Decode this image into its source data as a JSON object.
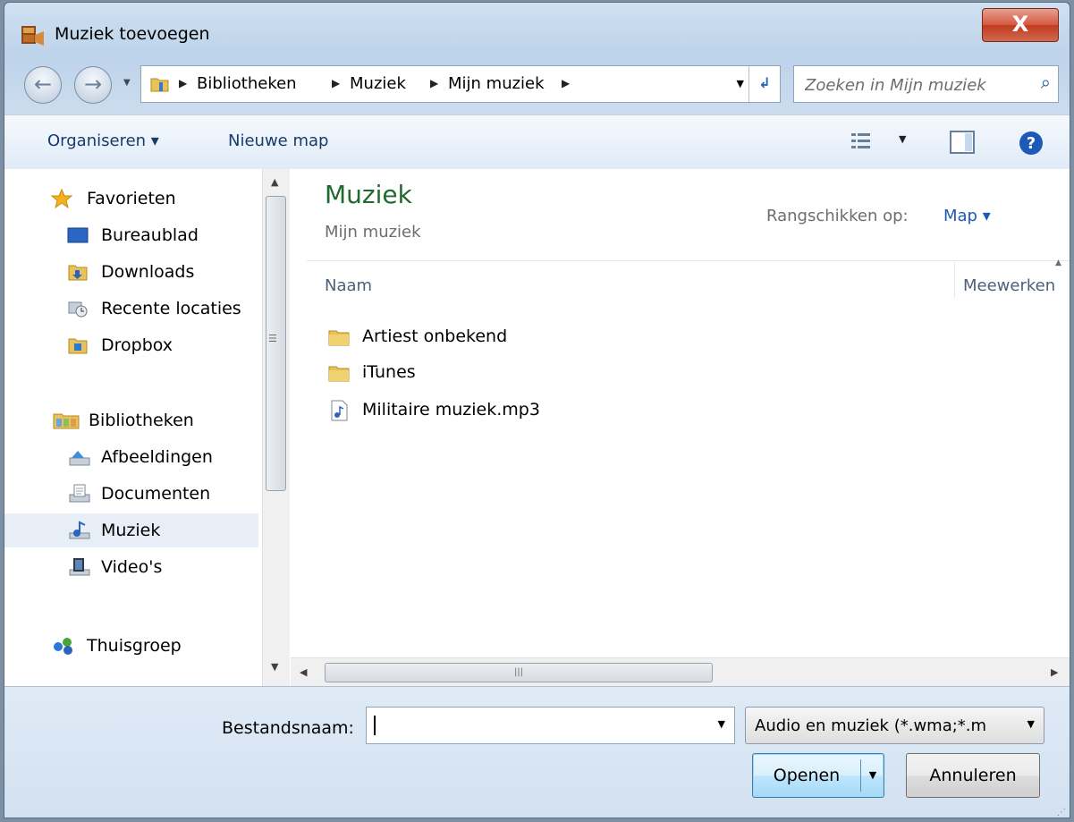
{
  "window": {
    "title": "Muziek toevoegen",
    "close_label": "X"
  },
  "navigation": {
    "back_glyph": "←",
    "forward_glyph": "→",
    "breadcrumbs": [
      "Bibliotheken",
      "Muziek",
      "Mijn muziek"
    ],
    "search_placeholder": "Zoeken in Mijn muziek"
  },
  "commandbar": {
    "organize_label": "Organiseren ▾",
    "new_folder_label": "Nieuwe map"
  },
  "sidebar": {
    "favorites_header": "Favorieten",
    "favorites": [
      "Bureaublad",
      "Downloads",
      "Recente locaties",
      "Dropbox"
    ],
    "libraries_header": "Bibliotheken",
    "libraries": [
      "Afbeeldingen",
      "Documenten",
      "Muziek",
      "Video's"
    ],
    "homegroup": "Thuisgroep",
    "selected": "Muziek"
  },
  "main": {
    "library_title": "Muziek",
    "library_subtitle": "Mijn muziek",
    "arrange_label": "Rangschikken op:",
    "arrange_value": "Map ▾",
    "columns": [
      "Naam",
      "Meewerken"
    ],
    "files": [
      {
        "name": "Artiest onbekend",
        "type": "folder"
      },
      {
        "name": "iTunes",
        "type": "folder"
      },
      {
        "name": "Militaire muziek.mp3",
        "type": "audio"
      }
    ]
  },
  "footer": {
    "filename_label": "Bestandsnaam:",
    "filename_value": "",
    "filter_value": "Audio en muziek (*.wma;*.m",
    "open_label": "Openen",
    "cancel_label": "Annuleren"
  },
  "colors": {
    "library_title": "#1e6a2f",
    "link_blue": "#1e5ab4",
    "close_red": "#c23a1f"
  }
}
